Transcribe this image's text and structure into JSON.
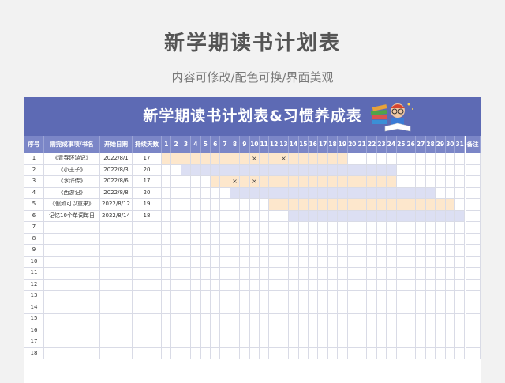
{
  "page": {
    "title": "新学期读书计划表",
    "subtitle": "内容可修改/配色可换/界面美观"
  },
  "sheet": {
    "banner_title": "新学期读书计划表&习惯养成表",
    "columns": {
      "index": "序号",
      "task": "需完成事项/书名",
      "start": "开始日期",
      "duration": "持续天数",
      "days": [
        "1",
        "2",
        "3",
        "4",
        "5",
        "6",
        "7",
        "8",
        "9",
        "10",
        "11",
        "12",
        "13",
        "14",
        "15",
        "16",
        "17",
        "18",
        "19",
        "20",
        "21",
        "22",
        "23",
        "24",
        "25",
        "26",
        "27",
        "28",
        "29",
        "30",
        "31"
      ],
      "notes": "备注"
    },
    "rows": [
      {
        "index": "1",
        "task": "《青春环游记》",
        "start": "2022/8/1",
        "duration": "17",
        "bar_start": 1,
        "bar_days": 19,
        "color": "orange",
        "marks": [
          10,
          13
        ]
      },
      {
        "index": "2",
        "task": "《小王子》",
        "start": "2022/8/3",
        "duration": "20",
        "bar_start": 3,
        "bar_days": 22,
        "color": "purple",
        "marks": []
      },
      {
        "index": "3",
        "task": "《水浒传》",
        "start": "2022/8/6",
        "duration": "17",
        "bar_start": 6,
        "bar_days": 19,
        "color": "orange",
        "marks": [
          8,
          10
        ]
      },
      {
        "index": "4",
        "task": "《西游记》",
        "start": "2022/8/8",
        "duration": "20",
        "bar_start": 8,
        "bar_days": 21,
        "color": "purple",
        "marks": []
      },
      {
        "index": "5",
        "task": "《假如可以重来》",
        "start": "2022/8/12",
        "duration": "19",
        "bar_start": 12,
        "bar_days": 19,
        "color": "orange",
        "marks": []
      },
      {
        "index": "6",
        "task": "记忆10个单词每日",
        "start": "2022/8/14",
        "duration": "18",
        "bar_start": 14,
        "bar_days": 18,
        "color": "purple",
        "marks": []
      },
      {
        "index": "7",
        "task": "",
        "start": "",
        "duration": ""
      },
      {
        "index": "8",
        "task": "",
        "start": "",
        "duration": ""
      },
      {
        "index": "9",
        "task": "",
        "start": "",
        "duration": ""
      },
      {
        "index": "10",
        "task": "",
        "start": "",
        "duration": ""
      },
      {
        "index": "11",
        "task": "",
        "start": "",
        "duration": ""
      },
      {
        "index": "12",
        "task": "",
        "start": "",
        "duration": ""
      },
      {
        "index": "13",
        "task": "",
        "start": "",
        "duration": ""
      },
      {
        "index": "14",
        "task": "",
        "start": "",
        "duration": ""
      },
      {
        "index": "15",
        "task": "",
        "start": "",
        "duration": ""
      },
      {
        "index": "16",
        "task": "",
        "start": "",
        "duration": ""
      },
      {
        "index": "17",
        "task": "",
        "start": "",
        "duration": ""
      },
      {
        "index": "18",
        "task": "",
        "start": "",
        "duration": ""
      }
    ],
    "mark_symbol": "×",
    "colors": {
      "banner": "#5d6ab4",
      "header": "#7b86c7",
      "orange_bar": "#fde7cc",
      "purple_bar": "#dcdff3"
    }
  }
}
